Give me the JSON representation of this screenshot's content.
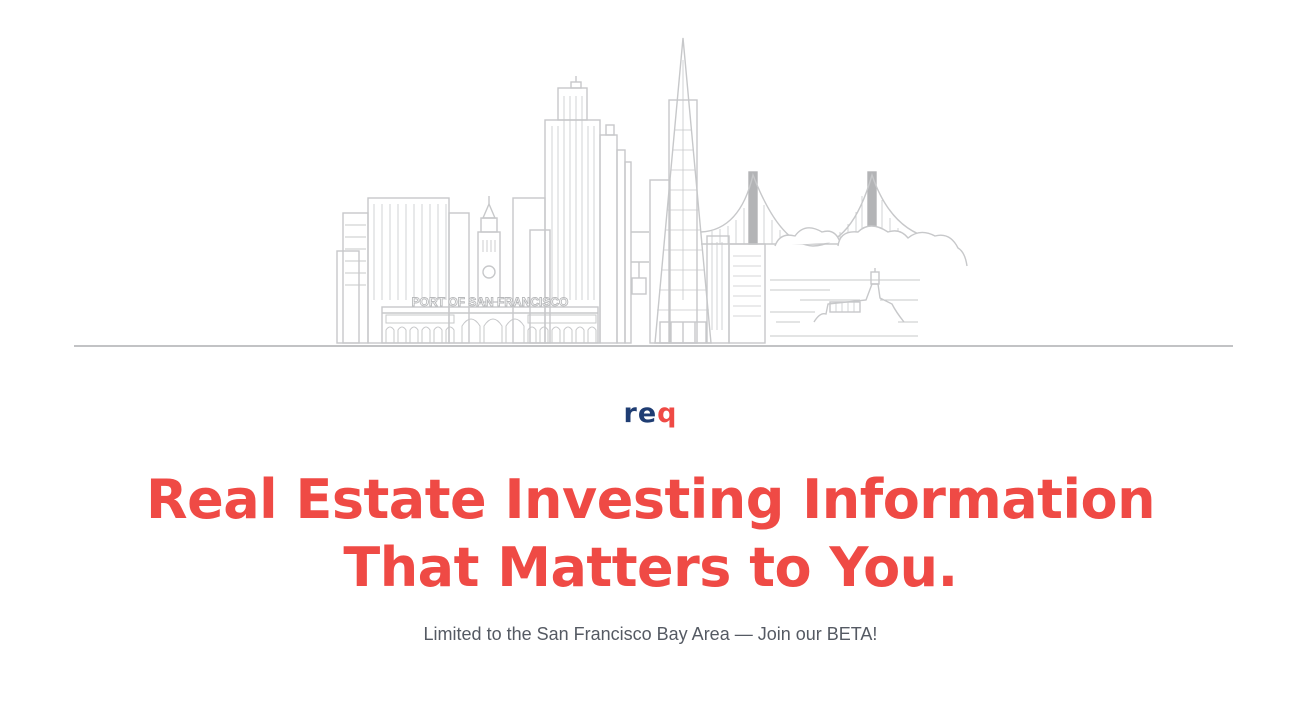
{
  "hero": {
    "illustration": {
      "name": "san-francisco-skyline",
      "sign_text": "PORT OF SAN FRANCISCO",
      "line_color": "#c7c8ca",
      "fill_color": "#b3b4b6"
    }
  },
  "brand": {
    "logo_part_1": "re",
    "logo_part_2": "q",
    "color_primary": "#1f3d73",
    "color_accent": "#ef4a45"
  },
  "headline": {
    "line1": "Real Estate Investing Information",
    "line2": "That Matters to You.",
    "color": "#ef4a45"
  },
  "subtitle": {
    "text": "Limited to the San Francisco Bay Area — Join our BETA!",
    "color": "#555a63"
  }
}
